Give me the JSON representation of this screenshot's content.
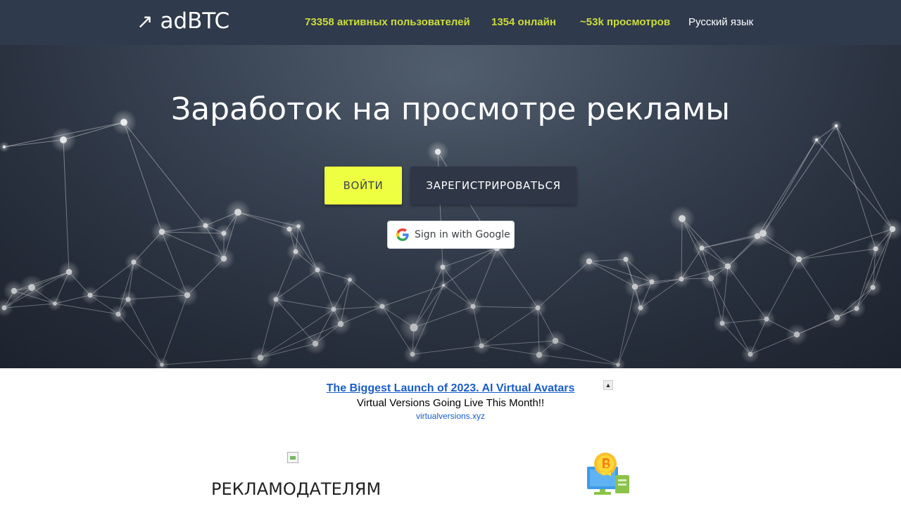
{
  "header": {
    "logo_arrow": "↗",
    "logo_text": "adBTC",
    "stats": {
      "active_users": "73358 активных пользователей",
      "online": "1354 онлайн",
      "views": "~53k просмотров"
    },
    "language": "Русский язык"
  },
  "hero": {
    "title": "Заработок на просмотре рекламы",
    "login_label": "ВОЙТИ",
    "register_label": "ЗАРЕГИСТРИРОВАТЬСЯ",
    "google_label": "Sign in with Google"
  },
  "ad": {
    "title": "The Biggest Launch of 2023. AI Virtual Avatars",
    "description": "Virtual Versions Going Live This Month!!",
    "url": "virtualversions.xyz"
  },
  "sections": {
    "advertisers_title": "РЕКЛАМОДАТЕЛЯМ"
  },
  "colors": {
    "accent": "#eeff41",
    "stat_text": "#cddc39",
    "header_bg": "#2f3a4c",
    "link": "#1a5dc9"
  },
  "icons": {
    "logo": "trending-arrow-icon",
    "google": "google-g-icon",
    "ad_choices": "ad-choices-icon",
    "earn_illustration": "bitcoin-monitor-icon"
  }
}
